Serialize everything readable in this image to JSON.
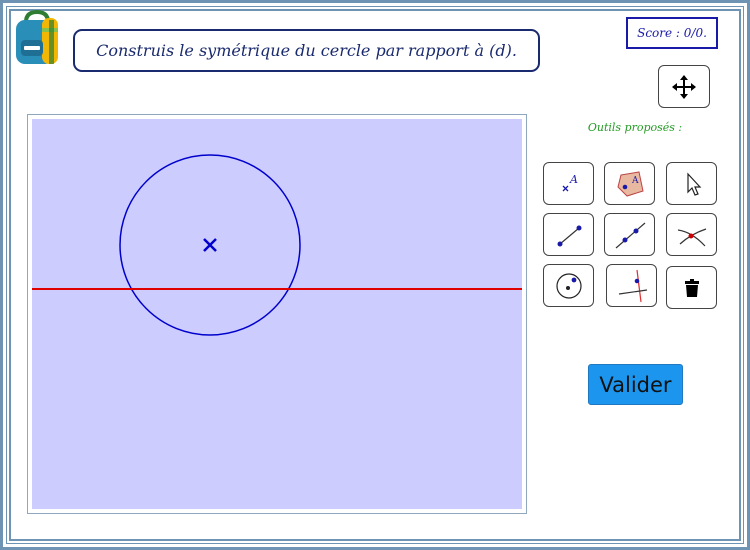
{
  "instruction": "Construis le symétrique du cercle par rapport à (d).",
  "score": "Score : 0/0.",
  "tools_title": "Outils proposés :",
  "validate_label": "Valider",
  "icons": {
    "logo": "backpack-icon",
    "move": "move-view-icon",
    "tools": [
      "point-icon",
      "polygon-icon",
      "pointer-icon",
      "segment-icon",
      "line-icon",
      "intersection-icon",
      "circle-icon",
      "perpendicular-icon",
      "delete-icon"
    ]
  },
  "colors": {
    "canvas_background": "#ccccff",
    "circle": "#0000cc",
    "axis_d": "#e00000",
    "validate_button": "#1c95ee",
    "instruction_text": "#1a2a6e",
    "tools_title": "#239b23"
  }
}
